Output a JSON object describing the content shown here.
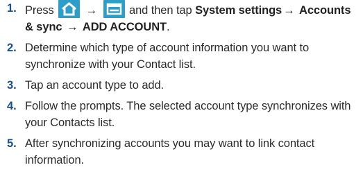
{
  "steps": [
    {
      "number": "1.",
      "press_word": "Press",
      "icon_1": "home-icon",
      "arrow_1": "→",
      "icon_2": "menu-icon",
      "then_text": "and then tap",
      "path": [
        "System settings",
        "Accounts & sync",
        "ADD ACCOUNT"
      ],
      "arrow_2": "→",
      "arrow_3": "→",
      "period": "."
    },
    {
      "number": "2.",
      "text": "Determine which type of account information you want to synchronize with your Contact list."
    },
    {
      "number": "3.",
      "text": "Tap an account type to add."
    },
    {
      "number": "4.",
      "text": "Follow the prompts. The selected account type synchronizes with your Contacts list."
    },
    {
      "number": "5.",
      "text": "After synchronizing accounts you may want to link contact information."
    }
  ],
  "colors": {
    "number": "#1a4f8a",
    "icon_bg": "#2d9ec9",
    "text": "#2b2b2b"
  }
}
